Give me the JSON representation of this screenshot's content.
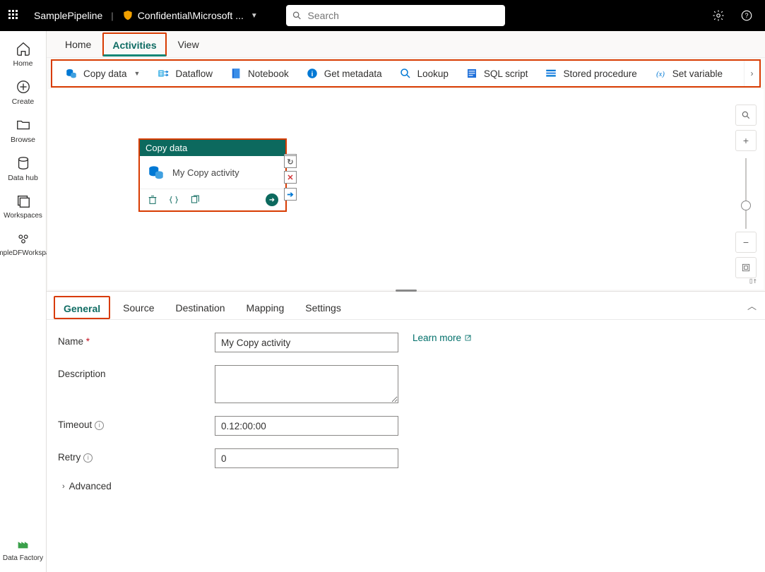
{
  "topbar": {
    "pipeline_name": "SamplePipeline",
    "brand_label": "Confidential\\Microsoft ...",
    "search_placeholder": "Search"
  },
  "leftrail": {
    "items": [
      {
        "label": "Home",
        "icon": "home"
      },
      {
        "label": "Create",
        "icon": "create"
      },
      {
        "label": "Browse",
        "icon": "browse"
      },
      {
        "label": "Data hub",
        "icon": "datahub"
      },
      {
        "label": "Workspaces",
        "icon": "workspaces"
      },
      {
        "label": "SampleDFWorkspace",
        "icon": "workspace"
      }
    ],
    "bottom": {
      "label": "Data Factory",
      "icon": "datafactory"
    }
  },
  "tabs": {
    "items": [
      "Home",
      "Activities",
      "View"
    ],
    "active_index": 1
  },
  "toolbar": {
    "items": [
      {
        "label": "Copy data",
        "icon": "copydata",
        "dropdown": true
      },
      {
        "label": "Dataflow",
        "icon": "dataflow"
      },
      {
        "label": "Notebook",
        "icon": "notebook"
      },
      {
        "label": "Get metadata",
        "icon": "getmeta"
      },
      {
        "label": "Lookup",
        "icon": "lookup"
      },
      {
        "label": "SQL script",
        "icon": "sql"
      },
      {
        "label": "Stored procedure",
        "icon": "proc"
      },
      {
        "label": "Set variable",
        "icon": "setvar"
      }
    ]
  },
  "activity_card": {
    "title": "Copy data",
    "name": "My Copy activity"
  },
  "prop_tabs": {
    "items": [
      "General",
      "Source",
      "Destination",
      "Mapping",
      "Settings"
    ],
    "active_index": 0
  },
  "general": {
    "name_label": "Name",
    "name_value": "My Copy activity",
    "learn_more": "Learn more",
    "description_label": "Description",
    "description_value": "",
    "timeout_label": "Timeout",
    "timeout_value": "0.12:00:00",
    "retry_label": "Retry",
    "retry_value": "0",
    "advanced_label": "Advanced"
  }
}
